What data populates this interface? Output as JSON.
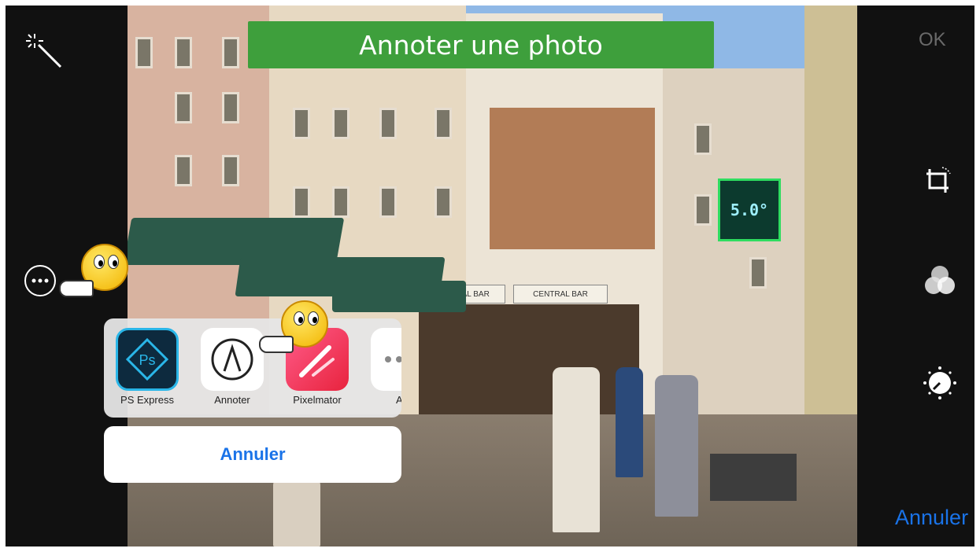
{
  "banner": {
    "title": "Annoter une photo"
  },
  "toolbar": {
    "ok_label": "OK",
    "cancel_label": "Annuler"
  },
  "photo": {
    "pharmacy_sign": "5.0°",
    "bar_sign_1": "CENTRAL BAR",
    "bar_sign_2": "CENTRAL BAR"
  },
  "share_sheet": {
    "apps": [
      {
        "label": "PS Express",
        "icon": "ps-express-icon"
      },
      {
        "label": "Annoter",
        "icon": "annotate-icon"
      },
      {
        "label": "Pixelmator",
        "icon": "pixelmator-icon"
      },
      {
        "label": "Au",
        "icon": "more-apps-icon"
      }
    ],
    "cancel_label": "Annuler"
  },
  "icons": {
    "left": [
      "magic-wand-icon",
      "more-options-icon"
    ],
    "right": [
      "crop-rotate-icon",
      "filters-icon",
      "adjust-dial-icon"
    ]
  },
  "colors": {
    "banner": "#3e9f3c",
    "accent": "#1a73e8"
  }
}
